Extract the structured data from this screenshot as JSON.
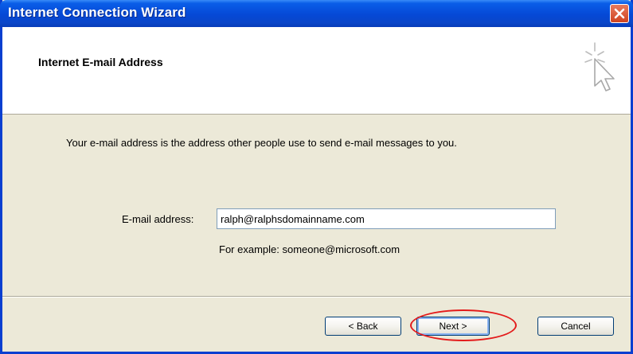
{
  "window": {
    "title": "Internet Connection Wizard"
  },
  "header": {
    "title": "Internet E-mail Address"
  },
  "body": {
    "description": "Your e-mail address is the address other people use to send e-mail messages to you.",
    "email_label": "E-mail address:",
    "email_value": "ralph@ralphsdomainname.com",
    "example_text": "For example: someone@microsoft.com"
  },
  "buttons": {
    "back_label": "< Back",
    "next_label": "Next >",
    "cancel_label": "Cancel"
  },
  "icons": {
    "close": "close-icon",
    "wizard": "wizard-cursor-icon"
  },
  "colors": {
    "titlebar": "#0548d6",
    "dialog_background": "#ece9d8",
    "close_button": "#d0431f",
    "highlight_ring": "#e31b1b"
  }
}
